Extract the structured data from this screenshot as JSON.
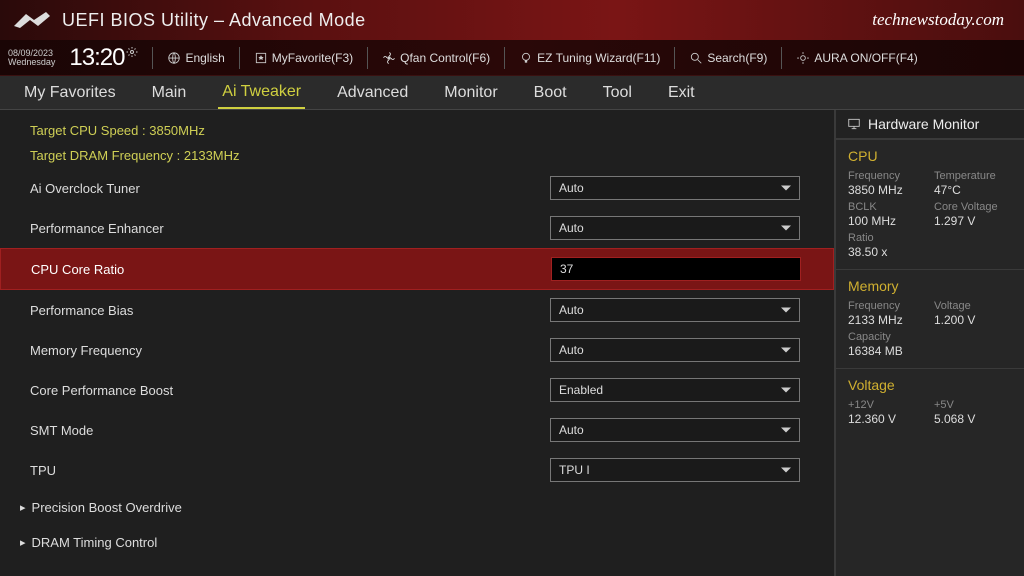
{
  "header": {
    "title": "UEFI BIOS Utility – Advanced Mode",
    "watermark": "technewstoday.com"
  },
  "info": {
    "date": "08/09/2023",
    "day": "Wednesday",
    "time": "13:20",
    "language": "English",
    "myfav": "MyFavorite(F3)",
    "qfan": "Qfan Control(F6)",
    "eztune": "EZ Tuning Wizard(F11)",
    "search": "Search(F9)",
    "aura": "AURA ON/OFF(F4)"
  },
  "tabs": [
    "My Favorites",
    "Main",
    "Ai Tweaker",
    "Advanced",
    "Monitor",
    "Boot",
    "Tool",
    "Exit"
  ],
  "activeTab": 2,
  "targets": {
    "cpu": "Target CPU Speed : 3850MHz",
    "dram": "Target DRAM Frequency : 2133MHz"
  },
  "settings": [
    {
      "label": "Ai Overclock Tuner",
      "value": "Auto",
      "type": "dropdown"
    },
    {
      "label": "Performance Enhancer",
      "value": "Auto",
      "type": "dropdown"
    },
    {
      "label": "CPU Core Ratio",
      "value": "37",
      "type": "input",
      "selected": true
    },
    {
      "label": "Performance Bias",
      "value": "Auto",
      "type": "dropdown"
    },
    {
      "label": "Memory Frequency",
      "value": "Auto",
      "type": "dropdown"
    },
    {
      "label": "Core Performance Boost",
      "value": "Enabled",
      "type": "dropdown"
    },
    {
      "label": "SMT Mode",
      "value": "Auto",
      "type": "dropdown"
    },
    {
      "label": "TPU",
      "value": "TPU I",
      "type": "dropdown"
    }
  ],
  "expanders": [
    "Precision Boost Overdrive",
    "DRAM Timing Control"
  ],
  "hw": {
    "title": "Hardware Monitor",
    "cpu": {
      "heading": "CPU",
      "freq_lbl": "Frequency",
      "freq_val": "3850 MHz",
      "temp_lbl": "Temperature",
      "temp_val": "47°C",
      "bclk_lbl": "BCLK",
      "bclk_val": "100 MHz",
      "cvolt_lbl": "Core Voltage",
      "cvolt_val": "1.297 V",
      "ratio_lbl": "Ratio",
      "ratio_val": "38.50 x"
    },
    "mem": {
      "heading": "Memory",
      "freq_lbl": "Frequency",
      "freq_val": "2133 MHz",
      "volt_lbl": "Voltage",
      "volt_val": "1.200 V",
      "cap_lbl": "Capacity",
      "cap_val": "16384 MB"
    },
    "volt": {
      "heading": "Voltage",
      "v12_lbl": "+12V",
      "v12_val": "12.360 V",
      "v5_lbl": "+5V",
      "v5_val": "5.068 V"
    }
  }
}
